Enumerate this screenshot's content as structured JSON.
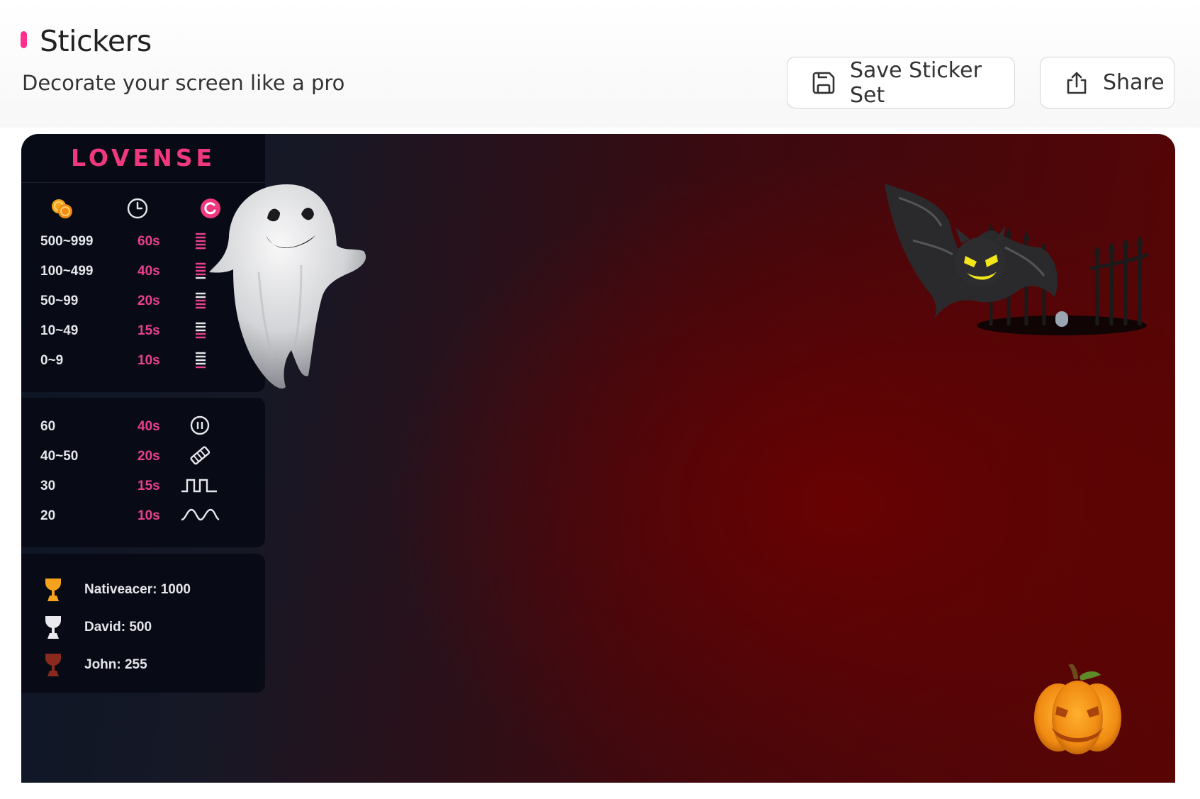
{
  "header": {
    "title": "Stickers",
    "subtitle": "Decorate your screen like a pro",
    "accent_color": "#ff2d8e"
  },
  "actions": {
    "save_label": "Save Sticker Set",
    "save_icon": "floppy-disk-icon",
    "share_label": "Share",
    "share_icon": "share-upload-icon"
  },
  "preview": {
    "brand": "LOVENSE",
    "brand_color": "#f0387f",
    "tip_table": {
      "header_icons": [
        "coins-icon",
        "clock-icon",
        "lovense-logo-icon"
      ],
      "rows": [
        {
          "level": "500~999",
          "time": "60s",
          "icon": "vibration-bars-icon"
        },
        {
          "level": "100~499",
          "time": "40s",
          "icon": "vibration-bars-icon"
        },
        {
          "level": "50~99",
          "time": "20s",
          "icon": "vibration-bars-icon"
        },
        {
          "level": "10~49",
          "time": "15s",
          "icon": "vibration-bars-icon"
        },
        {
          "level": "0~9",
          "time": "10s",
          "icon": "vibration-bars-icon"
        }
      ]
    },
    "special_table": {
      "rows": [
        {
          "level": "60",
          "time": "40s",
          "icon": "pause-icon"
        },
        {
          "level": "40~50",
          "time": "20s",
          "icon": "random-pattern-icon"
        },
        {
          "level": "30",
          "time": "15s",
          "icon": "pulse-wave-icon"
        },
        {
          "level": "20",
          "time": "10s",
          "icon": "sine-wave-icon"
        }
      ]
    },
    "leaderboard": [
      {
        "text": "Nativeacer: 1000",
        "icon": "gold-trophy-icon"
      },
      {
        "text": "David: 500",
        "icon": "silver-trophy-icon"
      },
      {
        "text": "John: 255",
        "icon": "bronze-trophy-icon"
      }
    ],
    "stickers": [
      "ghost-sticker",
      "bat-with-fence-sticker",
      "jack-o-lantern-sticker"
    ]
  }
}
